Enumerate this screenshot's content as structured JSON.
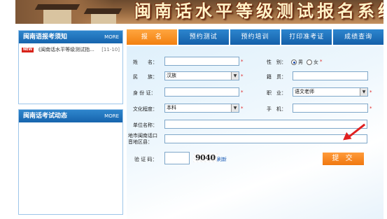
{
  "banner": {
    "title": "闽南话水平等级测试报名系统"
  },
  "panels": {
    "notice": {
      "title": "闽南语报考须知",
      "more": "MORE",
      "items": [
        {
          "badge": "NEW",
          "text": "《闽南话水平等级测试指...",
          "date": "[11-10]"
        }
      ]
    },
    "news": {
      "title": "闽南话考试动态",
      "more": "MORE"
    }
  },
  "tabs": [
    "报　名",
    "预约测试",
    "预约培训",
    "打印准考证",
    "成绩查询"
  ],
  "form": {
    "name_label": "姓　　名：",
    "gender_label": "性　别：",
    "gender_male": "男",
    "gender_female": "女",
    "ethnicity_label": "民　　族：",
    "ethnicity_value": "汉族",
    "native_label": "籍　贯：",
    "id_label": "身 份 证：",
    "job_label": "职　业：",
    "job_value": "语文老师",
    "edu_label": "文化程度：",
    "edu_value": "本科",
    "phone_label": "手　机：",
    "company_label": "单位名称：",
    "address_label": "地市闽南话口\n音地区县：",
    "captcha_label": "验 证 码：",
    "captcha_value": "9040",
    "refresh_label": "刷新",
    "required": "*",
    "submit_label": "提 交"
  },
  "colors": {
    "tab_blue": "#1664ad",
    "tab_active": "#f2800f",
    "required": "#e02020"
  }
}
